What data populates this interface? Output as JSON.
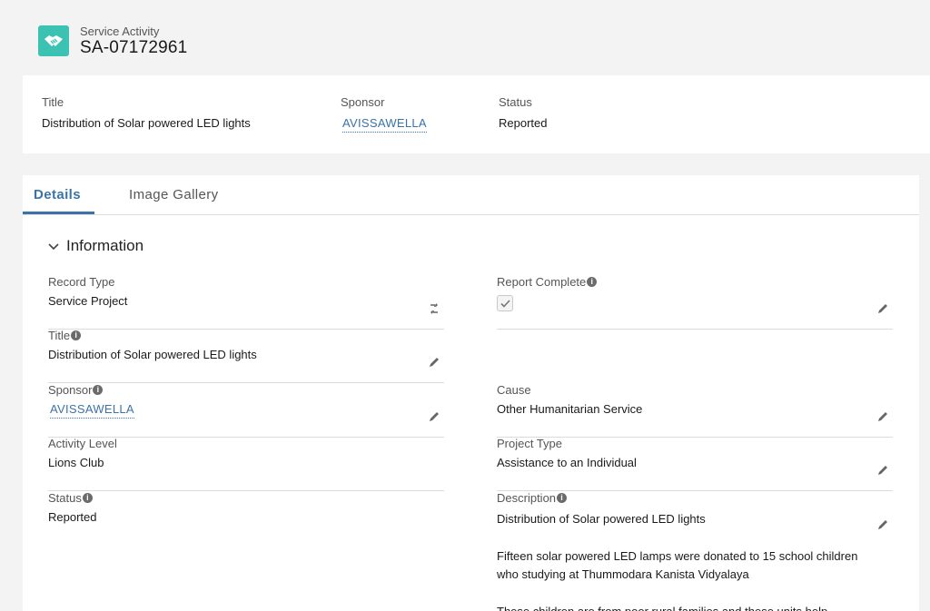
{
  "header": {
    "object_type": "Service Activity",
    "record_name": "SA-07172961",
    "icon": "handshake-icon",
    "icon_color": "#3cc2b3"
  },
  "highlights": {
    "title_label": "Title",
    "title_value": "Distribution of Solar powered LED lights",
    "sponsor_label": "Sponsor",
    "sponsor_value": "AVISSAWELLA",
    "status_label": "Status",
    "status_value": "Reported"
  },
  "tabs": [
    {
      "label": "Details",
      "active": true
    },
    {
      "label": "Image Gallery",
      "active": false
    }
  ],
  "section": {
    "title": "Information"
  },
  "fields": {
    "record_type": {
      "label": "Record Type",
      "value": "Service Project"
    },
    "report_complete": {
      "label": "Report Complete",
      "checked": true
    },
    "title": {
      "label": "Title",
      "value": "Distribution of Solar powered LED lights"
    },
    "sponsor": {
      "label": "Sponsor",
      "value": "AVISSAWELLA"
    },
    "cause": {
      "label": "Cause",
      "value": "Other Humanitarian Service"
    },
    "activity_level": {
      "label": "Activity Level",
      "value": "Lions Club"
    },
    "project_type": {
      "label": "Project Type",
      "value": "Assistance to an Individual"
    },
    "status": {
      "label": "Status",
      "value": "Reported"
    },
    "description": {
      "label": "Description",
      "paragraphs": [
        "Distribution of Solar powered LED lights",
        "Fifteen solar powered LED lamps were donated to 15 school children who studying at Thummodara Kanista Vidyalaya",
        "These children are from poor rural families and these units help"
      ]
    }
  },
  "colors": {
    "accent": "#3a73a8",
    "background": "#f3f3f3"
  }
}
